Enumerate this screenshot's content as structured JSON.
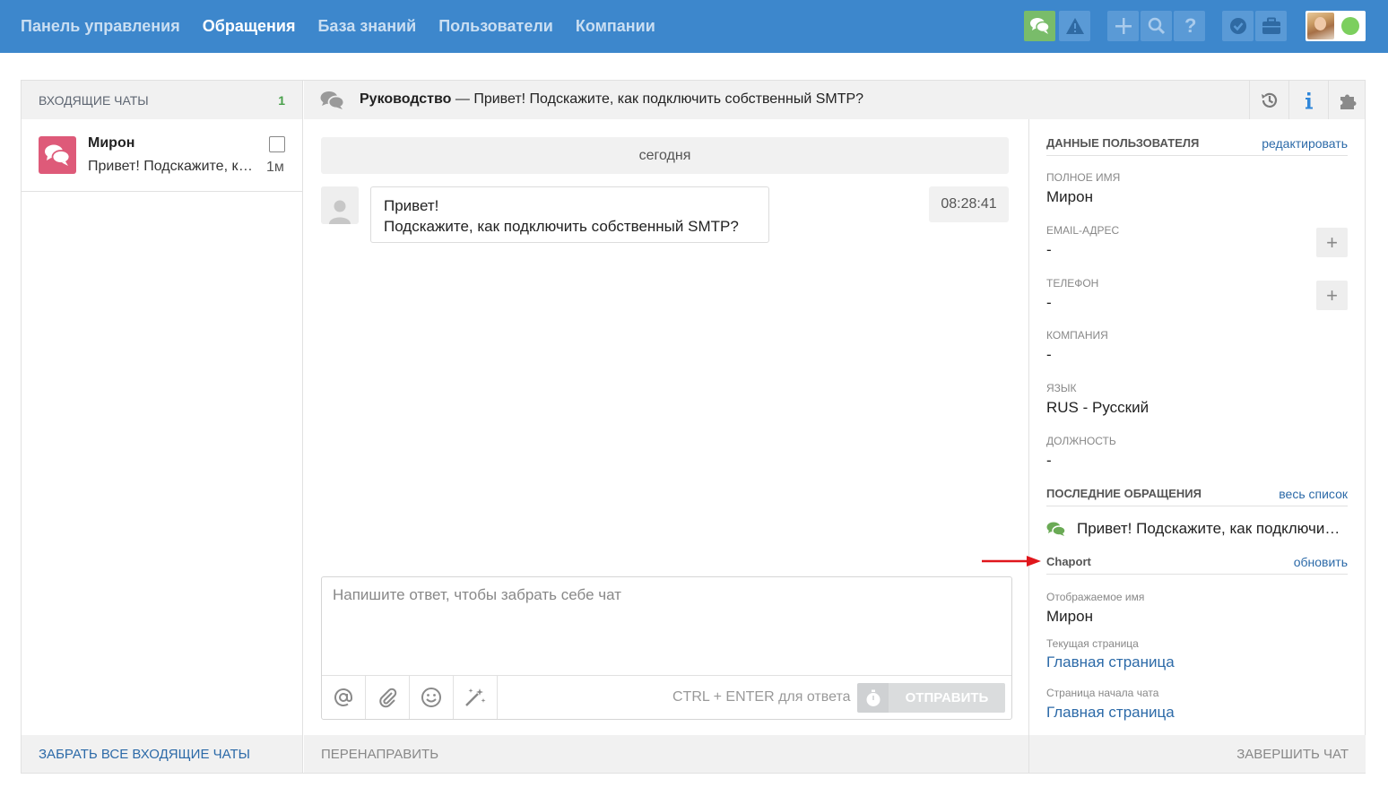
{
  "nav": {
    "items": [
      {
        "label": "Панель управления",
        "active": false
      },
      {
        "label": "Обращения",
        "active": true
      },
      {
        "label": "База знаний",
        "active": false
      },
      {
        "label": "Пользователи",
        "active": false
      },
      {
        "label": "Компании",
        "active": false
      }
    ]
  },
  "toolbar": {
    "icons": [
      "chat-icon",
      "warning-icon",
      "plus-icon",
      "search-icon",
      "help-icon",
      "shield-check-icon",
      "briefcase-icon"
    ],
    "user_status_color": "#7ccf5e"
  },
  "incoming": {
    "header": "ВХОДЯЩИЕ ЧАТЫ",
    "count": "1",
    "chats": [
      {
        "name": "Мирон",
        "preview": "Привет! Подскажите, как подключить собственный SMTP?",
        "time": "1м"
      }
    ],
    "footer": "ЗАБРАТЬ ВСЕ ВХОДЯЩИЕ ЧАТЫ"
  },
  "conversation": {
    "source": "Руководство",
    "dash": "—",
    "subject": "Привет! Подскажите, как подключить собственный SMTP?",
    "day_separator": "сегодня",
    "message": {
      "line1": "Привет!",
      "line2": "Подскажите, как подключить собственный SMTP?",
      "time": "08:28:41"
    },
    "composer": {
      "placeholder": "Напишите ответ, чтобы забрать себе чат",
      "hint": "CTRL + ENTER для ответа",
      "send_label": "ОТПРАВИТЬ"
    },
    "footer": "ПЕРЕНАПРАВИТЬ"
  },
  "user_panel": {
    "section_title": "ДАННЫЕ ПОЛЬЗОВАТЕЛЯ",
    "edit_link": "редактировать",
    "fields": {
      "full_name_label": "ПОЛНОЕ ИМЯ",
      "full_name": "Мирон",
      "email_label": "EMAIL-АДРЕС",
      "email": "-",
      "phone_label": "ТЕЛЕФОН",
      "phone": "-",
      "company_label": "КОМПАНИЯ",
      "company": "-",
      "language_label": "ЯЗЫК",
      "language": "RUS - Русский",
      "position_label": "ДОЛЖНОСТЬ",
      "position": "-"
    },
    "recent_title": "ПОСЛЕДНИЕ ОБРАЩЕНИЯ",
    "recent_link": "весь список",
    "recent_item": "Привет! Подскажите, как подключить собственный SMTP?",
    "chaport_title": "Chaport",
    "chaport_link": "обновить",
    "chaport": {
      "display_name_label": "Отображаемое имя",
      "display_name": "Мирон",
      "current_page_label": "Текущая страница",
      "current_page": "Главная страница",
      "start_page_label": "Страница начала чата",
      "start_page": "Главная страница"
    },
    "footer": "ЗАВЕРШИТЬ ЧАТ"
  },
  "colors": {
    "topbar": "#3d87cc",
    "chat_icon_bg": "#de5a79",
    "count_green": "#48a04a",
    "link_blue": "#2c6aa8",
    "annotation_arrow": "#e0161c"
  }
}
